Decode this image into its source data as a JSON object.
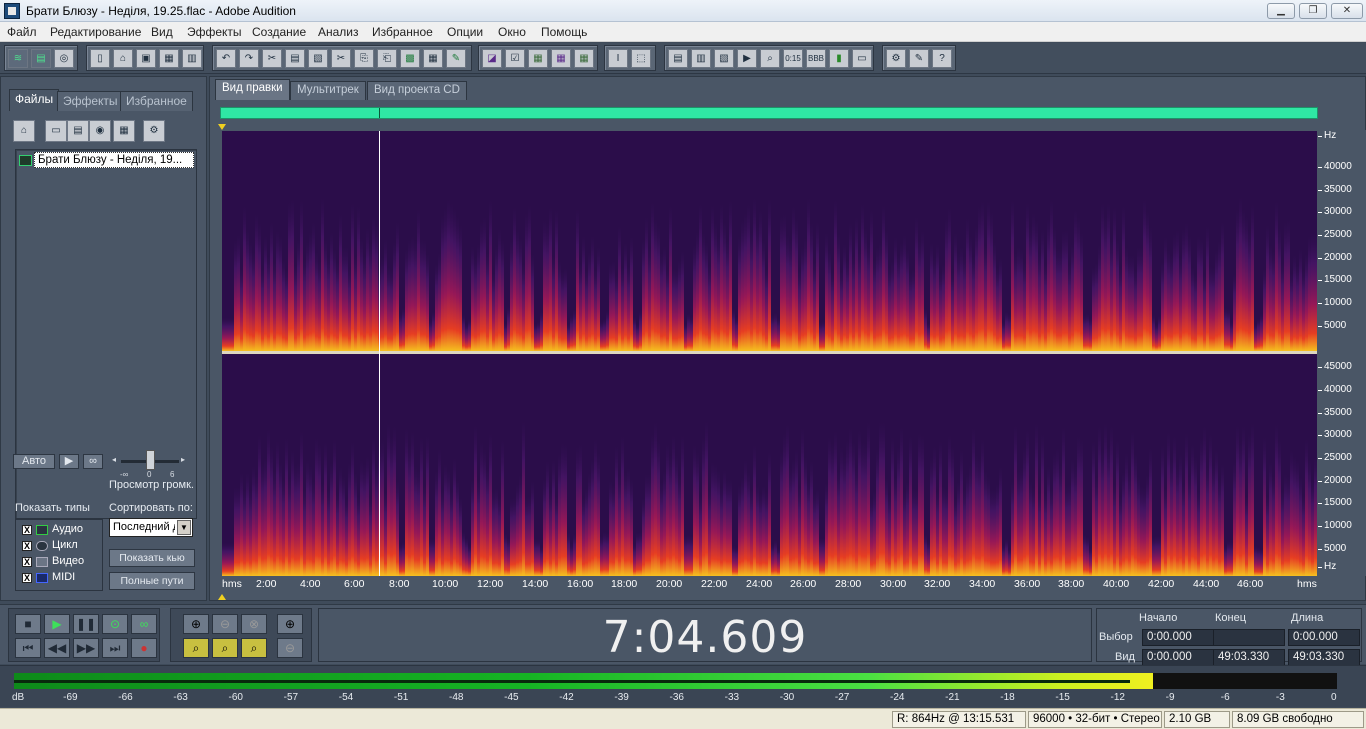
{
  "window": {
    "title": "Брати Блюзу - Неділя, 19.25.flac - Adobe Audition"
  },
  "menu": [
    "Файл",
    "Редактирование",
    "Вид",
    "Эффекты",
    "Создание",
    "Анализ",
    "Избранное",
    "Опции",
    "Окно",
    "Помощь"
  ],
  "left_panel": {
    "tabs": [
      "Файлы",
      "Эффекты",
      "Избранное"
    ],
    "file": "Брати Блюзу - Неділя, 19...",
    "auto_label": "Авто",
    "preview_volume_label": "Просмотр громк.",
    "slider_marks": [
      "-∞",
      "0",
      "6"
    ],
    "show_types_label": "Показать типы",
    "types": [
      {
        "label": "Аудио",
        "checked": "X"
      },
      {
        "label": "Цикл",
        "checked": "X"
      },
      {
        "label": "Видео",
        "checked": "X"
      },
      {
        "label": "MIDI",
        "checked": "X"
      }
    ],
    "sort_label": "Сортировать по:",
    "sort_value": "Последний д",
    "show_cue_button": "Показать кью",
    "full_paths_button": "Полные пути"
  },
  "main": {
    "tabs": [
      "Вид правки",
      "Мультитрек",
      "Вид проекта CD"
    ],
    "hz_unit": "Hz",
    "hz_ticks_top": [
      "40000",
      "35000",
      "30000",
      "25000",
      "20000",
      "15000",
      "10000",
      "5000"
    ],
    "hz_ticks_bottom": [
      "45000",
      "40000",
      "35000",
      "30000",
      "25000",
      "20000",
      "15000",
      "10000",
      "5000"
    ],
    "time_unit": "hms",
    "time_ticks": [
      "2:00",
      "4:00",
      "6:00",
      "8:00",
      "10:00",
      "12:00",
      "14:00",
      "16:00",
      "18:00",
      "20:00",
      "22:00",
      "24:00",
      "26:00",
      "28:00",
      "30:00",
      "32:00",
      "34:00",
      "36:00",
      "38:00",
      "40:00",
      "42:00",
      "44:00",
      "46:00"
    ]
  },
  "transport": {
    "time": "7:04.609",
    "columns": [
      "Начало",
      "Конец",
      "Длина"
    ],
    "selection_label": "Выбор",
    "view_label": "Вид",
    "selection": [
      "0:00.000",
      "",
      "0:00.000"
    ],
    "view": [
      "0:00.000",
      "49:03.330",
      "49:03.330"
    ]
  },
  "meter": {
    "labels": [
      "dB",
      "-69",
      "-66",
      "-63",
      "-60",
      "-57",
      "-54",
      "-51",
      "-48",
      "-45",
      "-42",
      "-39",
      "-36",
      "-33",
      "-30",
      "-27",
      "-24",
      "-21",
      "-18",
      "-15",
      "-12",
      "-9",
      "-6",
      "-3",
      "0"
    ],
    "level_db": -10
  },
  "status": {
    "cursor": "R: 864Hz @  13:15.531",
    "format": "96000 • 32-бит • Стерео",
    "size": "2.10 GB",
    "free": "8.09 GB свободно"
  },
  "colors": {
    "accent_overview": "#2fe8a4",
    "spectro_bg": "#2b0d4a",
    "spectro_hot": "#f5c020"
  }
}
